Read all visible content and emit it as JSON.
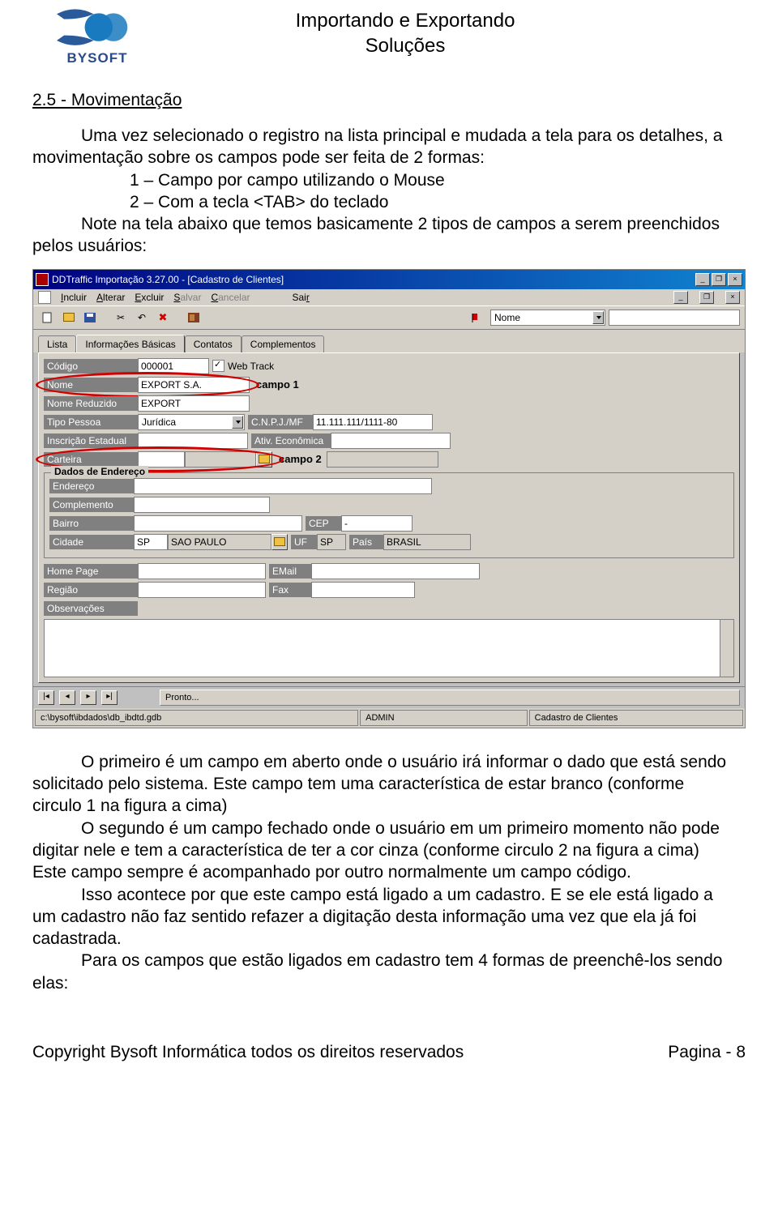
{
  "doc": {
    "header_title_line1": "Importando e Exportando",
    "header_title_line2": "Soluções",
    "brand": "BYSOFT"
  },
  "section": {
    "heading": "2.5 - Movimentação",
    "p1_l1": "Uma vez selecionado o registro na lista principal e mudada a tela para os detalhes, a",
    "p1_l2": "movimentação sobre os campos pode ser feita de 2 formas:",
    "p1_i1": "1 – Campo por campo utilizando o Mouse",
    "p1_i2": "2 – Com a tecla <TAB> do teclado",
    "p1_l3": "Note na tela abaixo que temos basicamente 2 tipos de campos a serem preenchidos",
    "p1_l4": "pelos usuários:"
  },
  "app": {
    "title": "DDTraffic Importação 3.27.00 - [Cadastro de Clientes]",
    "menu": {
      "incluir": "Incluir",
      "alterar": "Alterar",
      "excluir": "Excluir",
      "salvar": "Salvar",
      "cancelar": "Cancelar",
      "sair": "Sair"
    },
    "toolbar": {
      "search_field": "Nome"
    },
    "tabs": {
      "lista": "Lista",
      "info": "Informações Básicas",
      "contatos": "Contatos",
      "complementos": "Complementos"
    },
    "form": {
      "lbl_codigo": "Código",
      "val_codigo": "000001",
      "lbl_webtrack": "Web Track",
      "lbl_nome": "Nome",
      "val_nome": "EXPORT S.A.",
      "lbl_nome_red": "Nome Reduzido",
      "val_nome_red": "EXPORT",
      "lbl_tipo": "Tipo Pessoa",
      "val_tipo": "Jurídica",
      "lbl_cnpj": "C.N.P.J./MF",
      "val_cnpj": "11.111.111/1111-80",
      "lbl_inscricao": "Inscrição Estadual",
      "lbl_ativ": "Ativ. Econômica",
      "lbl_carteira": "Carteira",
      "group_addr": "Dados de Endereço",
      "lbl_end": "Endereço",
      "lbl_compl": "Complemento",
      "lbl_bairro": "Bairro",
      "lbl_cep": "CEP",
      "val_cep": "-",
      "lbl_cidade": "Cidade",
      "val_cidade_cod": "SP",
      "val_cidade": "SAO PAULO",
      "lbl_uf": "UF",
      "val_uf": "SP",
      "lbl_pais": "País",
      "val_pais": "BRASIL",
      "lbl_home": "Home Page",
      "lbl_email": "EMail",
      "lbl_regiao": "Região",
      "lbl_fax": "Fax",
      "lbl_obs": "Observações"
    },
    "annot": {
      "campo1": "campo 1",
      "campo2": "campo 2"
    },
    "status": {
      "ready": "Pronto...",
      "path": "c:\\bysoft\\ibdados\\db_ibdtd.gdb",
      "user": "ADMIN",
      "module": "Cadastro de Clientes"
    }
  },
  "after": {
    "p2_l1": "O primeiro é um campo em aberto onde o usuário irá informar o dado que está sendo",
    "p2_l2": "solicitado pelo sistema. Este campo tem uma característica de estar branco (conforme",
    "p2_l3": "circulo 1 na figura a cima)",
    "p2_l4": "O segundo é um campo fechado onde o usuário em um primeiro momento não pode",
    "p2_l5": "digitar nele e tem a característica de ter a cor cinza (conforme circulo 2 na figura a cima)",
    "p2_l6": "Este campo sempre é acompanhado por outro normalmente um campo código.",
    "p2_l7": "Isso acontece por que este campo está ligado a um cadastro. E se ele está ligado a",
    "p2_l8": "um cadastro não faz sentido  refazer a digitação desta informação uma vez que ela já foi",
    "p2_l9": "cadastrada.",
    "p2_l10": "Para os campos que estão ligados em cadastro tem 4 formas de preenchê-los sendo",
    "p2_l11": "elas:"
  },
  "footer": {
    "copyright": "Copyright Bysoft Informática todos os direitos reservados",
    "page": "Pagina -  8"
  }
}
